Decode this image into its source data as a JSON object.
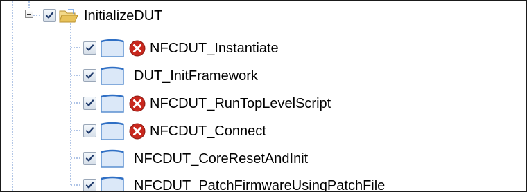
{
  "tree": {
    "root": {
      "label": "InitializeDUT",
      "checked": true,
      "expanded": true,
      "icon": "open-folder-icon"
    },
    "children": [
      {
        "label": "NFCDUT_Instantiate",
        "checked": true,
        "icon": "page-icon",
        "status": "error"
      },
      {
        "label": "DUT_InitFramework",
        "checked": true,
        "icon": "page-icon",
        "status": "none"
      },
      {
        "label": "NFCDUT_RunTopLevelScript",
        "checked": true,
        "icon": "page-icon",
        "status": "error"
      },
      {
        "label": "NFCDUT_Connect",
        "checked": true,
        "icon": "page-icon",
        "status": "error"
      },
      {
        "label": "NFCDUT_CoreResetAndInit",
        "checked": true,
        "icon": "page-icon",
        "status": "none"
      },
      {
        "label": "NFCDUT_PatchFirmwareUsingPatchFile",
        "checked": true,
        "icon": "page-icon",
        "status": "none"
      }
    ]
  },
  "colors": {
    "tree_line": "#7fa0d6",
    "error_icon": "#c8281e",
    "page_icon_fill": "#dbe8f8",
    "page_icon_edge": "#5b8fd0",
    "folder": "#e8c25a"
  }
}
